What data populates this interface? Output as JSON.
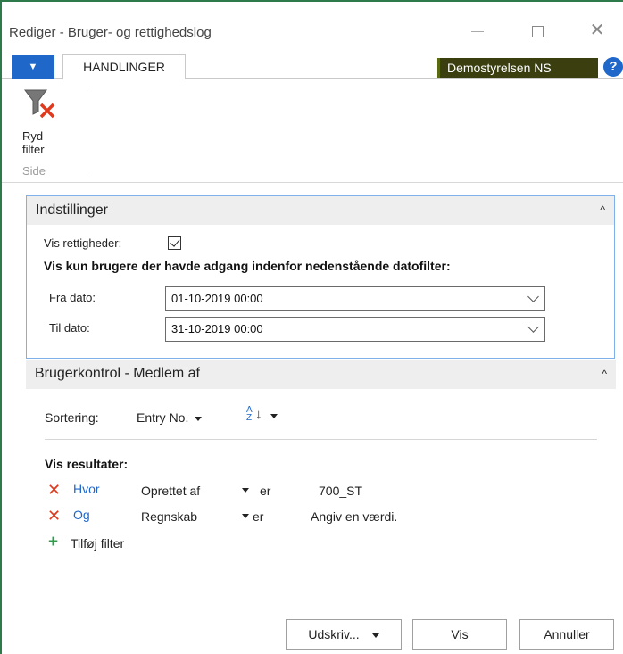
{
  "window": {
    "title": "Rediger - Bruger- og rettighedslog",
    "minimize_icon": "minimize-icon",
    "maximize_icon": "maximize-icon",
    "close_label": "✕"
  },
  "ribbon": {
    "menu_arrow": "▼",
    "tab_label": "HANDLINGER",
    "company": "Demostyrelsen NS",
    "help_label": "?",
    "clear_filter_line1": "Ryd",
    "clear_filter_line2": "filter",
    "group_label": "Side"
  },
  "settings": {
    "header": "Indstillinger",
    "collapse_icon": "^",
    "show_rights_label": "Vis rettigheder:",
    "show_rights_checked": true,
    "date_filter_heading": "Vis kun brugere der havde adgang indenfor nedenstående datofilter:",
    "from_label": "Fra dato:",
    "from_value": "01-10-2019 00:00",
    "to_label": "Til dato:",
    "to_value": "31-10-2019 00:00"
  },
  "usercontrol": {
    "header": "Brugerkontrol - Medlem af",
    "collapse_icon": "^",
    "sort_label": "Sortering:",
    "sort_field": "Entry No.",
    "az_top": "A",
    "az_bottom": "Z",
    "az_arrow": "↓",
    "results_label": "Vis resultater:",
    "filters": [
      {
        "conjunction": "Hvor",
        "field": "Oprettet af",
        "operator": "er",
        "value": "700_ST"
      },
      {
        "conjunction": "Og",
        "field": "Regnskab",
        "operator": "er",
        "value": "Angiv en værdi."
      }
    ],
    "add_filter_label": "Tilføj filter",
    "remove_symbol": "✕",
    "add_symbol": "+"
  },
  "footer": {
    "print_label": "Udskriv...",
    "show_label": "Vis",
    "cancel_label": "Annuller"
  },
  "colors": {
    "accent": "#1f67c9",
    "company_bg": "#3b3f10",
    "remove": "#e03a1e",
    "add": "#2e9b4a",
    "frame": "#2f7a4a"
  }
}
